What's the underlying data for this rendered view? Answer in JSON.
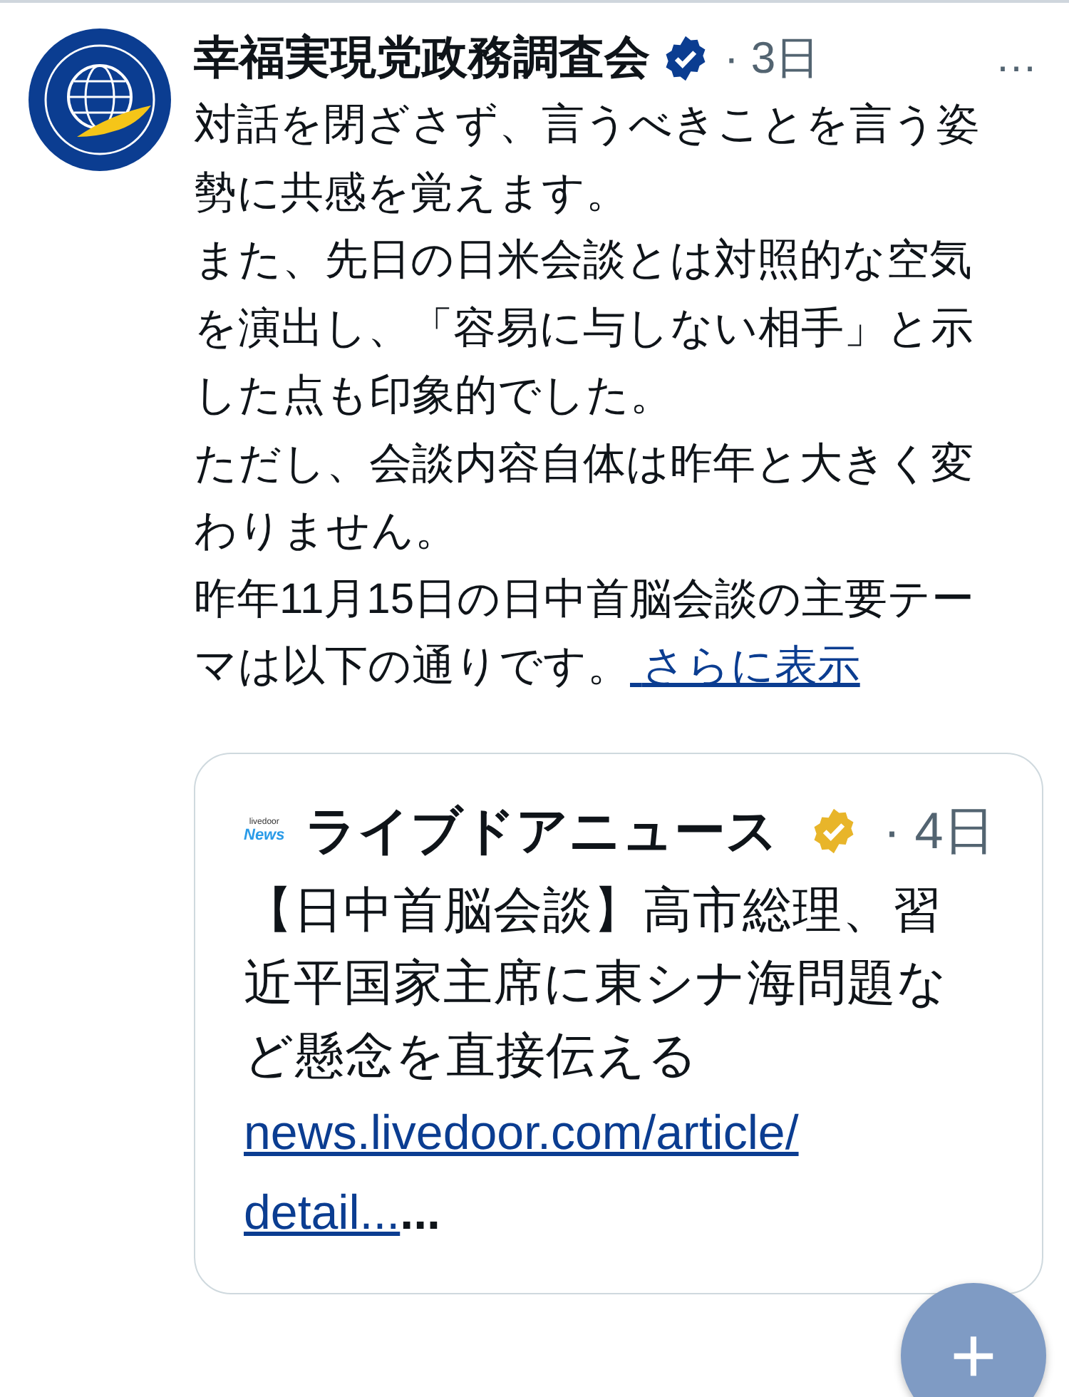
{
  "post": {
    "author": "幸福実現党政務調査会",
    "verified": true,
    "time": "· 3日",
    "more": "…",
    "paragraphs": [
      "対話を閉ざさず、言うべきことを言う姿勢に共感を覚えます。",
      "また、先日の日米会談とは対照的な空気を演出し、「容易に与しない相手」と示した点も印象的でした。",
      "ただし、会談内容自体は昨年と大きく変わりません。",
      "昨年11月15日の日中首脳会談の主要テーマは以下の通りです。"
    ],
    "show_more": "さらに表示"
  },
  "quote": {
    "source": "ライブドアニュース",
    "verified": true,
    "time": "· 4日",
    "logo_top": "livedoor",
    "logo_bottom": "News",
    "headline": "【日中首脳会談】高市総理、習近平国家主席に東シナ海問題など懸念を直接伝える",
    "link_lines": [
      "news.livedoor.com/article/",
      "detail..."
    ],
    "link_tail": "..."
  },
  "fab": {
    "label": "+"
  }
}
